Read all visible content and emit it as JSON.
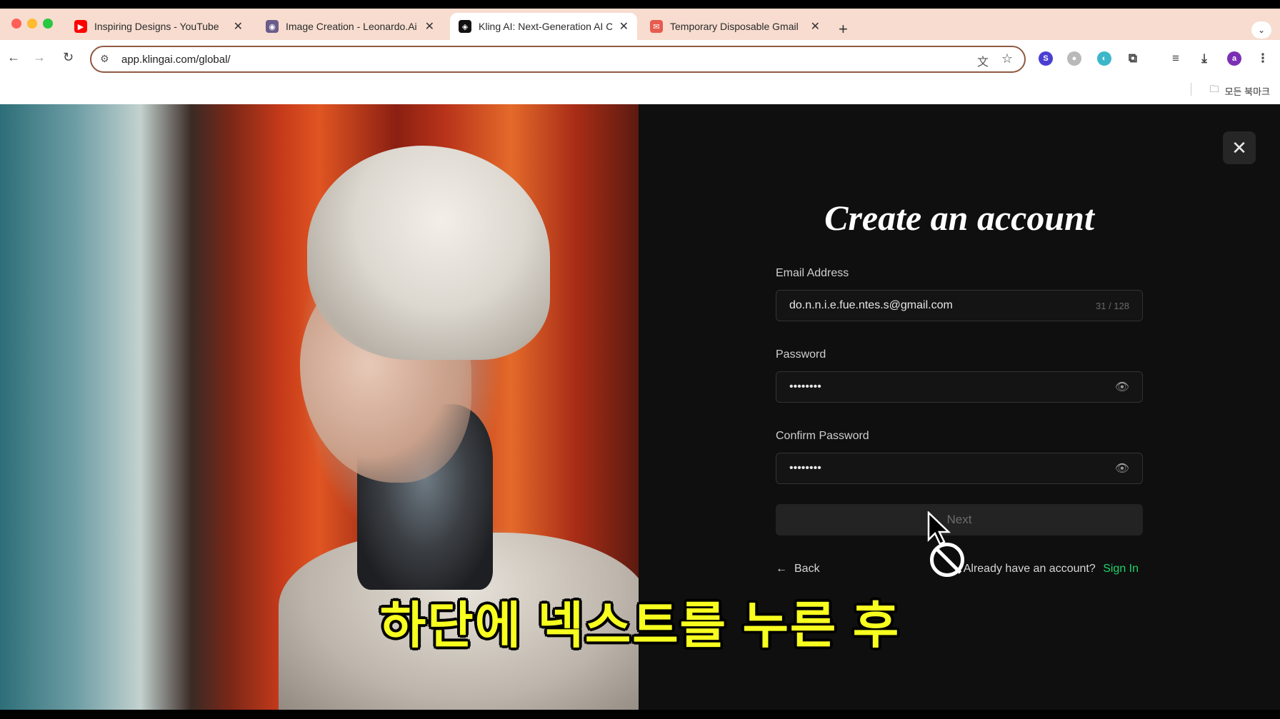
{
  "browser": {
    "tabs": [
      {
        "title": "Inspiring Designs - YouTube",
        "favicon_color": "#ff0000",
        "favicon": "▶"
      },
      {
        "title": "Image Creation - Leonardo.Ai",
        "favicon_color": "#6b5b8a",
        "favicon": "◉"
      },
      {
        "title": "Kling AI: Next-Generation AI C",
        "favicon_color": "#111111",
        "favicon": "◈"
      },
      {
        "title": "Temporary Disposable Gmail",
        "favicon_color": "#e65c4f",
        "favicon": "✉"
      }
    ],
    "new_tab": "+",
    "url": "app.klingai.com/global/",
    "bookmarks_label": "모든 북마크",
    "profile_initial": "a"
  },
  "signup": {
    "title": "Create an account",
    "email_label": "Email Address",
    "email_value": "do.n.n.i.e.fue.ntes.s@gmail.com",
    "email_counter": "31 / 128",
    "password_label": "Password",
    "password_value": "••••••••",
    "confirm_label": "Confirm Password",
    "confirm_value": "••••••••",
    "next_label": "Next",
    "back_label": "Back",
    "already_text": "Already have an account?",
    "signin_label": "Sign In"
  },
  "caption": "하단에 넥스트를 누른 후",
  "colors": {
    "accent_green": "#1fd36a",
    "caption_yellow": "#f7ff1f",
    "omnibox_border": "#8f5a43"
  }
}
